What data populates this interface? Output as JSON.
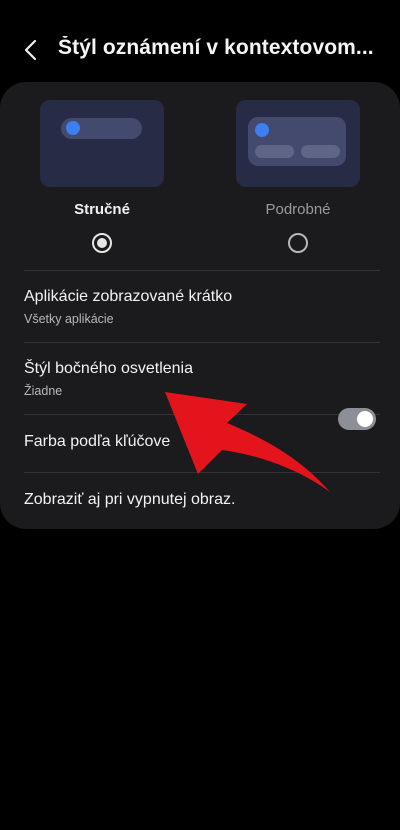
{
  "header": {
    "title": "Štýl oznámení v kontextovom...",
    "back_icon": "chevron-left-icon"
  },
  "style_options": [
    {
      "label": "Stručné",
      "selected": true
    },
    {
      "label": "Podrobné",
      "selected": false
    }
  ],
  "settings": [
    {
      "title": "Aplikácie zobrazované krátko",
      "subtitle": "Všetky aplikácie"
    },
    {
      "title": "Štýl bočného osvetlenia",
      "subtitle": "Žiadne"
    },
    {
      "title": "Farba podľa kľúčove"
    },
    {
      "title": "Zobraziť aj pri vypnutej obraz.",
      "toggle_on": true
    }
  ],
  "annotation": {
    "type": "red-arrow",
    "color": "#e3141b",
    "points_to": "Štýl bočného osvetlenia"
  },
  "colors": {
    "accent": "#3b7ff0",
    "card": "#1b1b1d",
    "preview": "#272b45"
  }
}
